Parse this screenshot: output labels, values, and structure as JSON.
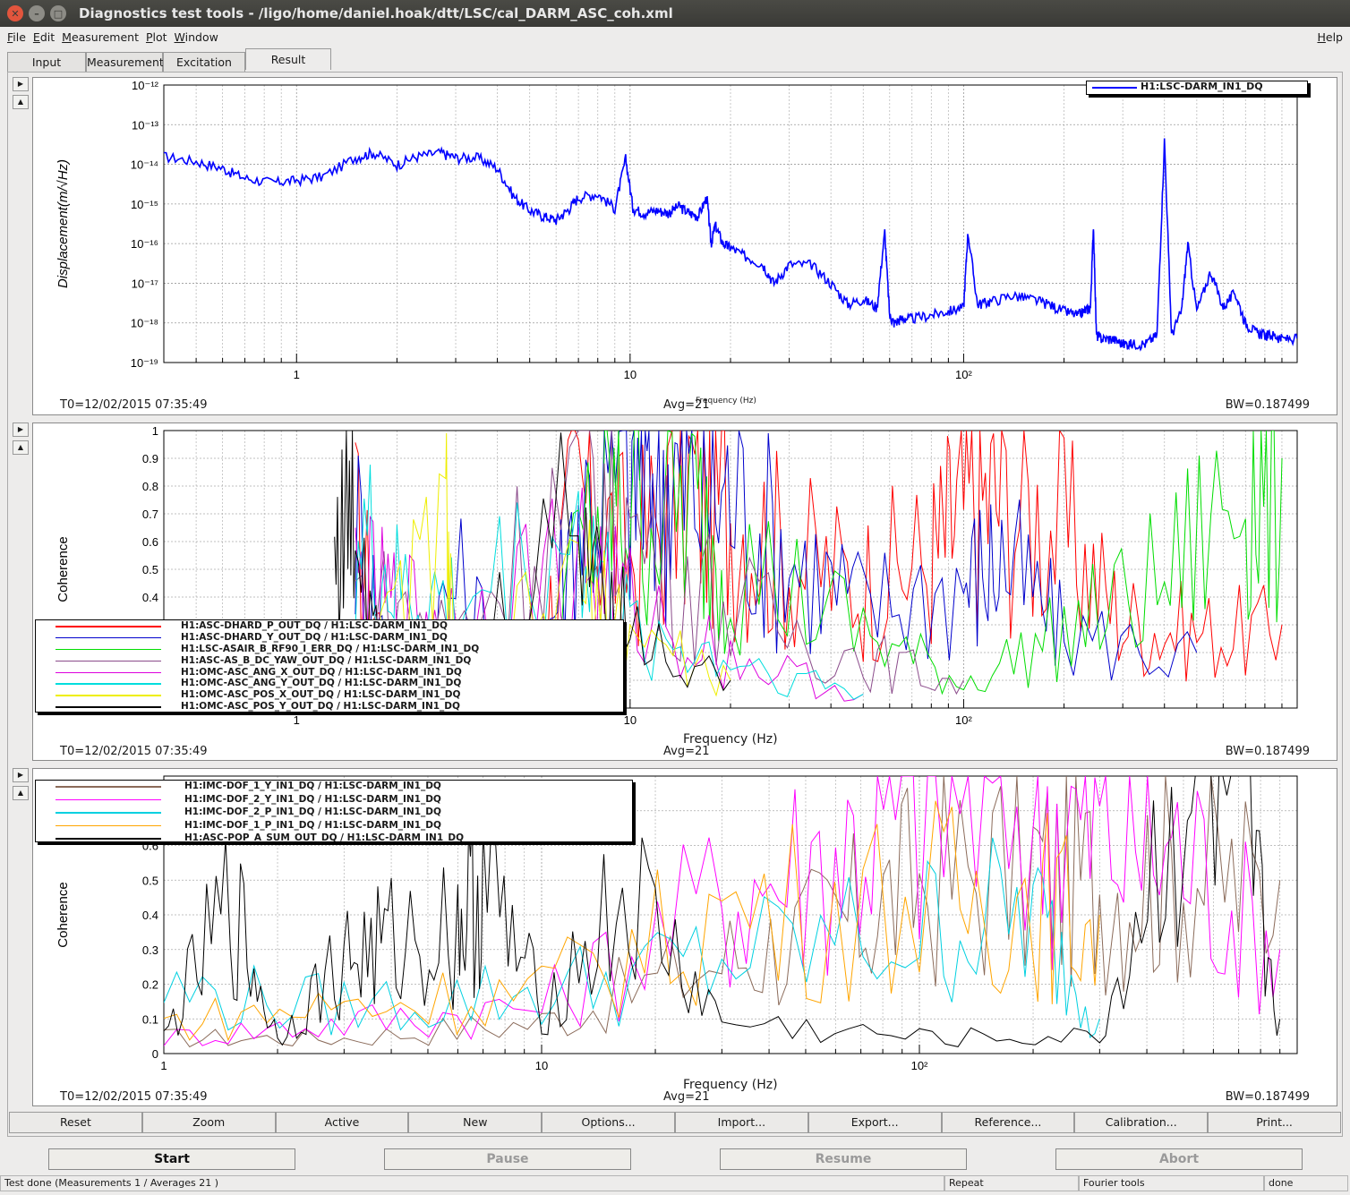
{
  "window": {
    "title": "Diagnostics test tools - /ligo/home/daniel.hoak/dtt/LSC/cal_DARM_ASC_coh.xml",
    "close_glyph": "✕",
    "min_glyph": "–",
    "max_glyph": "□"
  },
  "menu": {
    "items": [
      "File",
      "Edit",
      "Measurement",
      "Plot",
      "Window"
    ],
    "help": "Help"
  },
  "tabs": [
    "Input",
    "Measurement",
    "Excitation",
    "Result"
  ],
  "active_tab": "Result",
  "plots": [
    {
      "legend": [
        {
          "label": "H1:LSC-DARM_IN1_DQ",
          "color": "#0000ff"
        }
      ],
      "t0": "T0=12/02/2015 07:35:49",
      "avg": "Avg=21",
      "bw": "BW=0.187499",
      "ylabel": "Displacement(m/√Hz)",
      "xlabel": "Frequency (Hz)",
      "ytick_labels": [
        "10⁻¹²",
        "10⁻¹³",
        "10⁻¹⁴",
        "10⁻¹⁵",
        "10⁻¹⁶",
        "10⁻¹⁷",
        "10⁻¹⁸",
        "10⁻¹⁹"
      ],
      "xtick_labels": [
        "1",
        "10",
        "10²"
      ]
    },
    {
      "legend": [
        {
          "label": "H1:ASC-DHARD_P_OUT_DQ / H1:LSC-DARM_IN1_DQ",
          "color": "#ff0000"
        },
        {
          "label": "H1:ASC-DHARD_Y_OUT_DQ / H1:LSC-DARM_IN1_DQ",
          "color": "#0000cc"
        },
        {
          "label": "H1:LSC-ASAIR_B_RF90_I_ERR_DQ / H1:LSC-DARM_IN1_DQ",
          "color": "#00dd00"
        },
        {
          "label": "H1:ASC-AS_B_DC_YAW_OUT_DQ / H1:LSC-DARM_IN1_DQ",
          "color": "#8b4c8b"
        },
        {
          "label": "H1:OMC-ASC_ANG_X_OUT_DQ / H1:LSC-DARM_IN1_DQ",
          "color": "#dd00dd"
        },
        {
          "label": "H1:OMC-ASC_ANG_Y_OUT_DQ / H1:LSC-DARM_IN1_DQ",
          "color": "#00dddd"
        },
        {
          "label": "H1:OMC-ASC_POS_X_OUT_DQ / H1:LSC-DARM_IN1_DQ",
          "color": "#eeee00"
        },
        {
          "label": "H1:OMC-ASC_POS_Y_OUT_DQ / H1:LSC-DARM_IN1_DQ",
          "color": "#000000"
        }
      ],
      "t0": "T0=12/02/2015 07:35:49",
      "avg": "Avg=21",
      "bw": "BW=0.187499",
      "ylabel": "Coherence",
      "xlabel": "Frequency (Hz)",
      "ytick_labels": [
        "1",
        "0.9",
        "0.8",
        "0.7",
        "0.6",
        "0.5",
        "0.4"
      ],
      "xtick_labels": [
        "1",
        "10",
        "10²"
      ]
    },
    {
      "legend": [
        {
          "label": "H1:IMC-DOF_1_Y_IN1_DQ / H1:LSC-DARM_IN1_DQ",
          "color": "#8b6b5a"
        },
        {
          "label": "H1:IMC-DOF_2_Y_IN1_DQ / H1:LSC-DARM_IN1_DQ",
          "color": "#ff00ff"
        },
        {
          "label": "H1:IMC-DOF_2_P_IN1_DQ / H1:LSC-DARM_IN1_DQ",
          "color": "#00d0e0"
        },
        {
          "label": "H1:IMC-DOF_1_P_IN1_DQ / H1:LSC-DARM_IN1_DQ",
          "color": "#ffa500"
        },
        {
          "label": "H1:ASC-POP_A_SUM_OUT_DQ / H1:LSC-DARM_IN1_DQ",
          "color": "#000000"
        }
      ],
      "t0": "T0=12/02/2015 07:35:49",
      "avg": "Avg=21",
      "bw": "BW=0.187499",
      "ylabel": "Coherence",
      "xlabel": "Frequency (Hz)",
      "ytick_labels": [
        "0.7",
        "0.6",
        "0.5",
        "0.4",
        "0.3",
        "0.2",
        "0.1",
        "0"
      ],
      "xtick_labels": [
        "1",
        "10",
        "10²"
      ]
    }
  ],
  "plot_buttons": [
    "Reset",
    "Zoom",
    "Active",
    "New",
    "Options...",
    "Import...",
    "Export...",
    "Reference...",
    "Calibration...",
    "Print..."
  ],
  "run_buttons": [
    {
      "label": "Start",
      "enabled": true
    },
    {
      "label": "Pause",
      "enabled": false
    },
    {
      "label": "Resume",
      "enabled": false
    },
    {
      "label": "Abort",
      "enabled": false
    }
  ],
  "status": {
    "message": "Test done (Measurements 1 / Averages 21 )",
    "repeat": "Repeat",
    "tool": "Fourier tools",
    "state": "done"
  },
  "chart_data": [
    {
      "type": "line",
      "xlabel": "Frequency (Hz)",
      "ylabel": "Displacement(m/√Hz)",
      "xscale": "log",
      "yscale": "log",
      "xlim": [
        0.4,
        1000
      ],
      "ylim": [
        1e-19,
        1e-12
      ],
      "legend": "top-right",
      "grid": true,
      "series": [
        {
          "name": "H1:LSC-DARM_IN1_DQ",
          "color": "#0000ff",
          "x": [
            0.4,
            0.5,
            0.6,
            0.7,
            0.85,
            1.0,
            1.2,
            1.5,
            1.7,
            2.0,
            2.3,
            2.7,
            3.0,
            3.5,
            4.0,
            4.5,
            5.0,
            5.5,
            6.0,
            6.5,
            7.0,
            8.0,
            9.0,
            9.7,
            10.2,
            11,
            12,
            13,
            14,
            15,
            16,
            17,
            17.5,
            18,
            19,
            20,
            22,
            25,
            27,
            30,
            35,
            40,
            45,
            50,
            55,
            58,
            60,
            62,
            65,
            70,
            80,
            90,
            100,
            103,
            110,
            120,
            140,
            160,
            180,
            200,
            220,
            230,
            240,
            245,
            250,
            260,
            280,
            300,
            320,
            350,
            380,
            400,
            420,
            450,
            470,
            500,
            550,
            600,
            650,
            700,
            750,
            800,
            850,
            900,
            1000
          ],
          "y": [
            1.6e-14,
            1.2e-14,
            8e-15,
            4.5e-15,
            3.5e-15,
            4e-15,
            5e-15,
            1.5e-14,
            2e-14,
            1e-14,
            1.6e-14,
            2e-14,
            1.5e-14,
            1.5e-14,
            8e-15,
            1.5e-15,
            7e-16,
            5e-16,
            4e-16,
            7e-16,
            1.5e-15,
            1.8e-15,
            8e-16,
            1.4e-14,
            8e-16,
            6e-16,
            7e-16,
            6e-16,
            9e-16,
            6e-16,
            5e-16,
            1.5e-15,
            1e-16,
            3e-16,
            1e-16,
            8e-17,
            5e-17,
            3e-17,
            1e-17,
            3e-17,
            3e-17,
            1e-17,
            3e-18,
            4e-18,
            2.5e-18,
            2e-16,
            1.5e-18,
            1e-18,
            1.3e-18,
            1.3e-18,
            1.6e-18,
            2e-18,
            2.5e-18,
            2e-16,
            3e-18,
            3.5e-18,
            5e-18,
            4e-18,
            3e-18,
            2e-18,
            1.6e-18,
            2e-18,
            2.5e-18,
            3e-16,
            5e-19,
            4e-19,
            4e-19,
            3e-19,
            3e-19,
            3e-19,
            5e-19,
            4e-14,
            5e-19,
            2e-18,
            1e-16,
            2e-18,
            2e-17,
            2.5e-18,
            6e-18,
            1e-18,
            6e-19,
            5e-19,
            5e-19,
            4e-19,
            4e-19
          ]
        }
      ]
    },
    {
      "type": "line",
      "xlabel": "Frequency (Hz)",
      "ylabel": "Coherence",
      "xscale": "log",
      "xlim": [
        0.4,
        1000
      ],
      "ylim": [
        0,
        1
      ],
      "legend": "top-left",
      "grid": true,
      "series": [
        {
          "name": "H1:ASC-DHARD_P_OUT_DQ / H1:LSC-DARM_IN1_DQ",
          "x": [
            1.5,
            2,
            3,
            5,
            7,
            10,
            15,
            20,
            30,
            50,
            80,
            100,
            130,
            200,
            300,
            500,
            900
          ],
          "y": [
            0.7,
            0.05,
            0.05,
            0.1,
            0.85,
            0.6,
            0.9,
            0.8,
            0.6,
            0.5,
            0.6,
            0.8,
            0.85,
            0.7,
            0.35,
            0.3,
            0.3
          ]
        },
        {
          "name": "H1:ASC-DHARD_Y_OUT_DQ / H1:LSC-DARM_IN1_DQ",
          "x": [
            1.5,
            2,
            3,
            5,
            7,
            10,
            12,
            15,
            20,
            30,
            50,
            100,
            130,
            200,
            500
          ],
          "y": [
            0.75,
            0.05,
            0.5,
            0.05,
            0.8,
            0.95,
            0.95,
            0.9,
            0.85,
            0.6,
            0.4,
            0.5,
            0.6,
            0.3,
            0.2
          ]
        },
        {
          "name": "H1:LSC-ASAIR_B_RF90_I_ERR_DQ / H1:LSC-DARM_IN1_DQ",
          "x": [
            1.5,
            3,
            5,
            8,
            10,
            15,
            20,
            50,
            100,
            200,
            400,
            700,
            900
          ],
          "y": [
            0.05,
            0.05,
            0.05,
            0.8,
            0.85,
            0.8,
            0.6,
            0.3,
            0.1,
            0.3,
            0.5,
            0.9,
            0.9
          ]
        },
        {
          "name": "H1:ASC-AS_B_DC_YAW_OUT_DQ / H1:LSC-DARM_IN1_DQ",
          "x": [
            1.5,
            3,
            7,
            10,
            20,
            50,
            100
          ],
          "y": [
            0.45,
            0.3,
            0.9,
            0.7,
            0.4,
            0.2,
            0.1
          ]
        },
        {
          "name": "H1:OMC-ASC_ANG_X_OUT_DQ / H1:LSC-DARM_IN1_DQ",
          "x": [
            1.5,
            2,
            3,
            7,
            10,
            20,
            50
          ],
          "y": [
            0.5,
            0.4,
            0.35,
            0.6,
            0.4,
            0.2,
            0.05
          ]
        },
        {
          "name": "H1:OMC-ASC_ANG_Y_OUT_DQ / H1:LSC-DARM_IN1_DQ",
          "x": [
            1.5,
            2,
            3,
            7,
            10,
            20,
            50
          ],
          "y": [
            0.7,
            0.45,
            0.4,
            0.7,
            0.3,
            0.2,
            0.05
          ]
        },
        {
          "name": "H1:OMC-ASC_POS_X_OUT_DQ / H1:LSC-DARM_IN1_DQ",
          "x": [
            1.5,
            2.8,
            3,
            7,
            10,
            20
          ],
          "y": [
            0.05,
            0.75,
            0.1,
            0.5,
            0.3,
            0.1
          ]
        },
        {
          "name": "H1:OMC-ASC_POS_Y_OUT_DQ / H1:LSC-DARM_IN1_DQ",
          "x": [
            1.3,
            1.5,
            2,
            3,
            7,
            10,
            20
          ],
          "y": [
            0.65,
            0.77,
            0.05,
            0.1,
            0.8,
            0.3,
            0.1
          ]
        }
      ]
    },
    {
      "type": "line",
      "xlabel": "Frequency (Hz)",
      "ylabel": "Coherence",
      "xscale": "log",
      "xlim": [
        1,
        1000
      ],
      "ylim": [
        0,
        0.8
      ],
      "legend": "top-left",
      "grid": true,
      "series": [
        {
          "name": "H1:IMC-DOF_1_Y_IN1_DQ / H1:LSC-DARM_IN1_DQ",
          "x": [
            1,
            3,
            10,
            30,
            60,
            100,
            200,
            300,
            500,
            900
          ],
          "y": [
            0.05,
            0.05,
            0.1,
            0.3,
            0.4,
            0.55,
            0.6,
            0.55,
            0.6,
            0.5
          ]
        },
        {
          "name": "H1:IMC-DOF_2_Y_IN1_DQ / H1:LSC-DARM_IN1_DQ",
          "x": [
            1,
            3,
            10,
            30,
            60,
            100,
            200,
            300,
            500,
            900
          ],
          "y": [
            0.05,
            0.1,
            0.15,
            0.5,
            0.65,
            0.8,
            0.8,
            0.7,
            0.65,
            0.3
          ]
        },
        {
          "name": "H1:IMC-DOF_2_P_IN1_DQ / H1:LSC-DARM_IN1_DQ",
          "x": [
            1,
            3,
            10,
            30,
            100,
            200,
            300
          ],
          "y": [
            0.2,
            0.15,
            0.2,
            0.3,
            0.4,
            0.45,
            0.1
          ]
        },
        {
          "name": "H1:IMC-DOF_1_P_IN1_DQ / H1:LSC-DARM_IN1_DQ",
          "x": [
            1,
            3,
            10,
            30,
            100,
            200,
            300
          ],
          "y": [
            0.1,
            0.15,
            0.2,
            0.45,
            0.5,
            0.5,
            0.4
          ]
        },
        {
          "name": "H1:ASC-POP_A_SUM_OUT_DQ / H1:LSC-DARM_IN1_DQ",
          "x": [
            1,
            1.5,
            2,
            3,
            4,
            6,
            7,
            10,
            17,
            30,
            100,
            300,
            500,
            700,
            900
          ],
          "y": [
            0.05,
            0.48,
            0.05,
            0.3,
            0.35,
            0.4,
            0.55,
            0.15,
            0.5,
            0.1,
            0.05,
            0.05,
            0.85,
            0.8,
            0.1
          ]
        }
      ]
    }
  ]
}
